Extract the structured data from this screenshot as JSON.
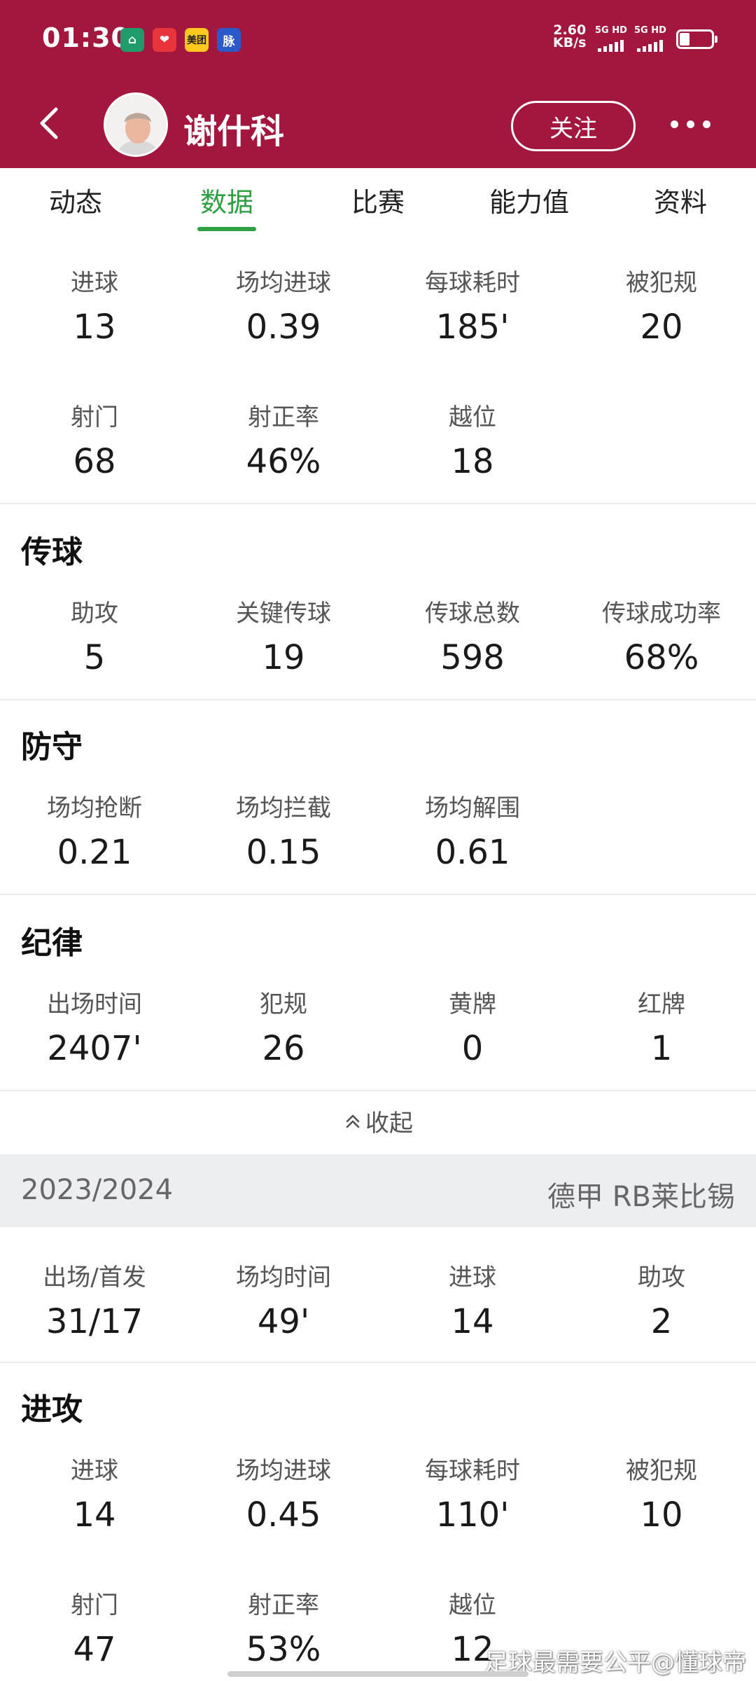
{
  "status_bar": {
    "time": "01:30",
    "app_icons": [
      {
        "name": "home-app-icon",
        "glyph": "⌂",
        "color": "#1f9c6a"
      },
      {
        "name": "heart-app-icon",
        "glyph": "❤",
        "color": "#e8353c"
      },
      {
        "name": "meituan-app-icon",
        "glyph": "美团",
        "color": "#ffc81e"
      },
      {
        "name": "maimai-app-icon",
        "glyph": "脉",
        "color": "#2a59c9"
      }
    ],
    "net_speed_value": "2.60",
    "net_speed_unit": "KB/s",
    "signal1_label": "5G HD",
    "signal2_label": "5G HD"
  },
  "header": {
    "player_name": "谢什科",
    "follow_label": "关注",
    "bg_color": "#a3173f"
  },
  "tabs": [
    "动态",
    "数据",
    "比赛",
    "能力值",
    "资料"
  ],
  "active_tab": "数据",
  "sections": {
    "attack_1": [
      {
        "label": "进球",
        "value": "13"
      },
      {
        "label": "场均进球",
        "value": "0.39"
      },
      {
        "label": "每球耗时",
        "value": "185'"
      },
      {
        "label": "被犯规",
        "value": "20"
      }
    ],
    "attack_2": [
      {
        "label": "射门",
        "value": "68"
      },
      {
        "label": "射正率",
        "value": "46%"
      },
      {
        "label": "越位",
        "value": "18"
      }
    ],
    "passing": {
      "title": "传球",
      "stats": [
        {
          "label": "助攻",
          "value": "5"
        },
        {
          "label": "关键传球",
          "value": "19"
        },
        {
          "label": "传球总数",
          "value": "598"
        },
        {
          "label": "传球成功率",
          "value": "68%"
        }
      ]
    },
    "defense": {
      "title": "防守",
      "stats": [
        {
          "label": "场均抢断",
          "value": "0.21"
        },
        {
          "label": "场均拦截",
          "value": "0.15"
        },
        {
          "label": "场均解围",
          "value": "0.61"
        }
      ]
    },
    "discipline": {
      "title": "纪律",
      "stats": [
        {
          "label": "出场时间",
          "value": "2407'"
        },
        {
          "label": "犯规",
          "value": "26"
        },
        {
          "label": "黄牌",
          "value": "0"
        },
        {
          "label": "红牌",
          "value": "1"
        }
      ]
    }
  },
  "collapse_label": "收起",
  "season": {
    "year": "2023/2024",
    "league": "德甲 RB莱比锡",
    "summary": [
      {
        "label": "出场/首发",
        "value": "31/17"
      },
      {
        "label": "场均时间",
        "value": "49'"
      },
      {
        "label": "进球",
        "value": "14"
      },
      {
        "label": "助攻",
        "value": "2"
      }
    ],
    "attack_title": "进攻",
    "attack_1": [
      {
        "label": "进球",
        "value": "14"
      },
      {
        "label": "场均进球",
        "value": "0.45"
      },
      {
        "label": "每球耗时",
        "value": "110'"
      },
      {
        "label": "被犯规",
        "value": "10"
      }
    ],
    "attack_2": [
      {
        "label": "射门",
        "value": "47"
      },
      {
        "label": "射正率",
        "value": "53%"
      },
      {
        "label": "越位",
        "value": "12"
      }
    ]
  },
  "watermark": "足球最需要公平@懂球帝",
  "accent_color": "#2ea043"
}
